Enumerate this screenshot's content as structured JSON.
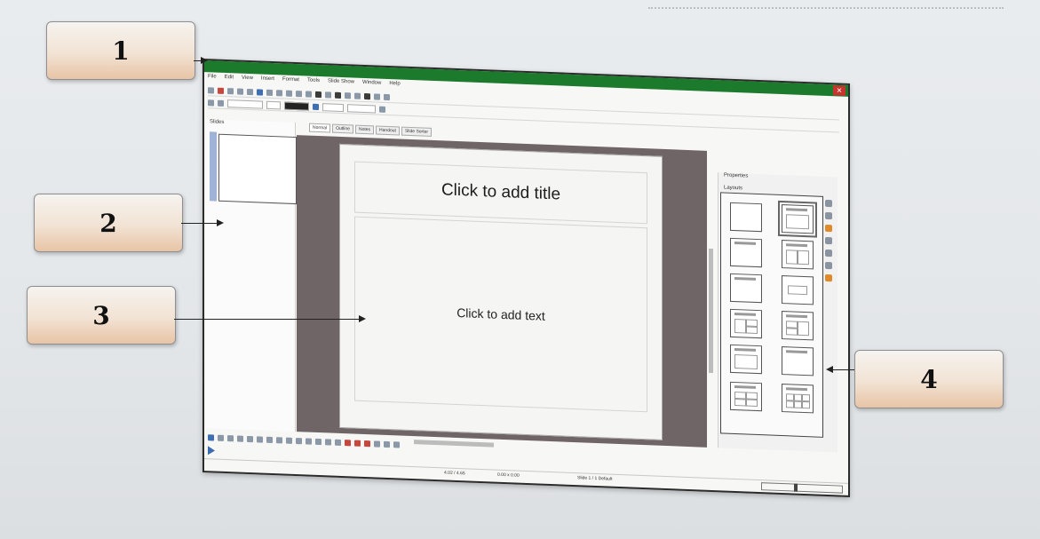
{
  "callouts": [
    "1",
    "2",
    "3",
    "4"
  ],
  "app": {
    "menu": [
      "File",
      "Edit",
      "View",
      "Insert",
      "Format",
      "Tools",
      "Slide Show",
      "Window",
      "Help"
    ],
    "slides_pane_title": "Slides",
    "view_tabs": [
      "Normal",
      "Outline",
      "Notes",
      "Handout",
      "Slide Sorter"
    ],
    "slide": {
      "title_placeholder": "Click to add title",
      "body_placeholder": "Click to add text"
    },
    "properties": {
      "title": "Properties",
      "layouts_title": "Layouts"
    },
    "status": {
      "position": "4.02 / 4.65",
      "size": "0.00 x 0.00",
      "slide": "Slide 1 / 1 Default"
    },
    "colors": {
      "titlebar": "#1b7a2c",
      "close": "#c9332d",
      "canvas": "#6f6566",
      "callout_accent": "#e8c4a6"
    }
  }
}
